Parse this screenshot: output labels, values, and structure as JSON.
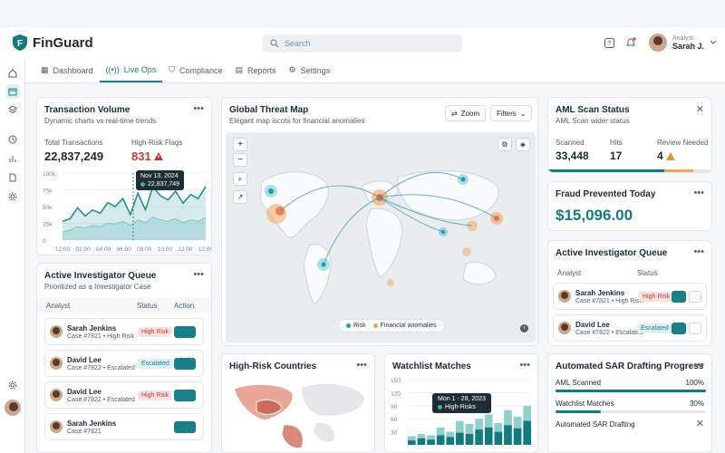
{
  "app": {
    "name": "FinGuard"
  },
  "search": {
    "placeholder": "Search"
  },
  "user": {
    "role": "Analyst",
    "name": "Sarah J."
  },
  "tabs": [
    {
      "label": "Dashboard",
      "icon": "grid-icon"
    },
    {
      "label": "Live Ops",
      "icon": "broadcast-icon"
    },
    {
      "label": "Compliance",
      "icon": "shield-icon"
    },
    {
      "label": "Reports",
      "icon": "document-icon"
    },
    {
      "label": "Settings",
      "icon": "gear-icon"
    }
  ],
  "sidebar": {
    "icons": [
      "home-icon",
      "calendar-icon",
      "layers-icon",
      "clock-icon",
      "bar-chart-icon",
      "document-icon",
      "gear-icon",
      "settings-icon"
    ]
  },
  "txn": {
    "title": "Transaction Volume",
    "subtitle": "Dynamic charts vs real-time trends",
    "total_label": "Total Transactions",
    "total_value": "22,837,249",
    "flags_label": "High-Risk Flags",
    "flags_value": "831",
    "tooltip_date": "Nov 13, 2024",
    "tooltip_value": "22,837,749",
    "chart_data": {
      "type": "area",
      "x": [
        "12:00",
        "02:00",
        "04:00",
        "06:00",
        "08:00",
        "10:00",
        "12:00",
        "12:00"
      ],
      "y_ticks": [
        "100k",
        "75k",
        "50k",
        "25k",
        "0"
      ],
      "ylim": [
        0,
        100
      ],
      "series": [
        {
          "values": [
            28,
            32,
            48,
            36,
            45,
            40,
            56,
            50,
            62,
            38,
            70,
            45,
            80,
            66,
            60,
            73,
            55,
            68,
            62,
            80
          ]
        },
        {
          "values": [
            12,
            15,
            20,
            18,
            22,
            20,
            25,
            24,
            28,
            22,
            30,
            26,
            34,
            30,
            28,
            32,
            26,
            30,
            28,
            34
          ]
        }
      ]
    }
  },
  "map": {
    "title": "Global Threat Map",
    "subtitle": "Elegant map iscots for financial anomalies",
    "zoom_label": "Zoom",
    "filters_label": "Filters",
    "legend": [
      {
        "label": "Risk",
        "color": "#2a9aa6"
      },
      {
        "label": "Financial anomalies",
        "color": "#f0a55a"
      }
    ]
  },
  "aml": {
    "title": "AML Scan Status",
    "subtitle": "AML Scan wider status",
    "scanned_label": "Scanned",
    "scanned_value": "33,448",
    "hits_label": "Hits",
    "hits_value": "17",
    "review_label": "Review Needed",
    "review_value": "4"
  },
  "fraud": {
    "title": "Fraud Prevented Today",
    "value": "$15,096.00"
  },
  "queue_right": {
    "title": "Active Investigator Queue",
    "col_analyst": "Analyst",
    "col_status": "Status",
    "rows": [
      {
        "name": "Sarah Jenkins",
        "case": "Case #7821 • High Risk",
        "status": "High Risk"
      },
      {
        "name": "David Lee",
        "case": "Case #7822 • Escalated",
        "status": "Escalated"
      }
    ]
  },
  "queue_left": {
    "title": "Active Investigator Queue",
    "subtitle": "Prioritized as a Investigator Case",
    "col_analyst": "Analyst",
    "col_status": "Status",
    "col_action": "Action",
    "rows": [
      {
        "name": "Sarah Jenkins",
        "case": "Case #7821 • High Risk",
        "status": "High Risk"
      },
      {
        "name": "David Lee",
        "case": "Case #7822 • Escalated",
        "status": "Escalated"
      },
      {
        "name": "David Lee",
        "case": "Case #7822 • Escalated",
        "status": "High Risk"
      },
      {
        "name": "Sarah Jenkins",
        "case": "Case #7821",
        "status": ""
      }
    ]
  },
  "countries": {
    "title": "High-Risk Countries"
  },
  "watchlist": {
    "title": "Watchlist Matches",
    "tooltip_date": "Mon 1 - 28, 2023",
    "tooltip_label": "High-Risks",
    "chart_data": {
      "type": "bar",
      "y_ticks": [
        "150",
        "120",
        "90",
        "60",
        "30"
      ],
      "ylim": [
        0,
        150
      ],
      "series": [
        {
          "values": [
            10,
            15,
            12,
            22,
            18,
            28,
            25,
            35,
            40,
            30,
            45,
            38,
            55
          ]
        },
        {
          "values": [
            20,
            25,
            22,
            40,
            30,
            55,
            48,
            60,
            70,
            50,
            80,
            65,
            90
          ]
        }
      ]
    }
  },
  "sar": {
    "title": "Automated SAR Drafting Progress",
    "items": [
      {
        "label": "AML Scanned",
        "pct": "100%",
        "fill": 1.0
      },
      {
        "label": "Watchlist Matches",
        "pct": "30%",
        "fill": 0.3
      },
      {
        "label": "Automated SAR Drafting",
        "pct": "",
        "fill": 0.0
      }
    ]
  }
}
